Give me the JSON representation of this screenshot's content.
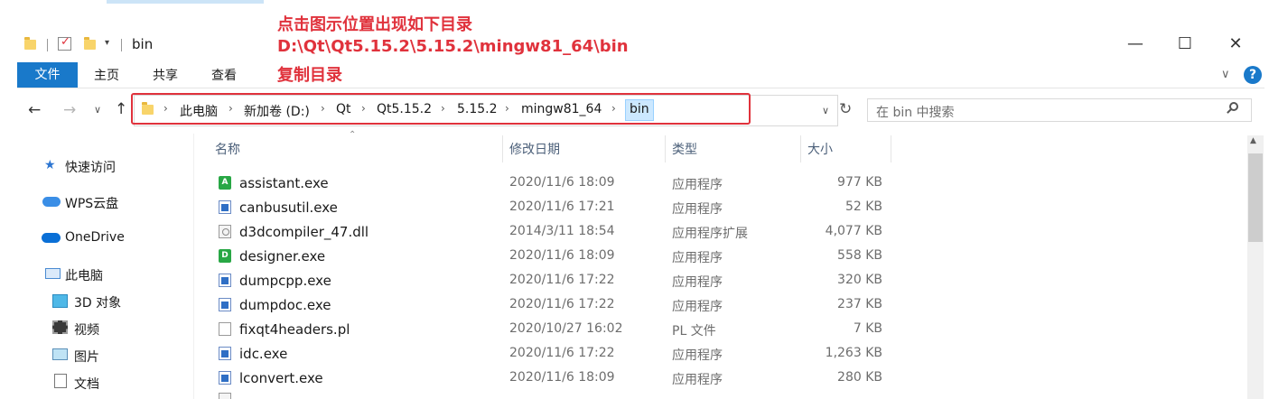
{
  "window": {
    "title": "bin",
    "minimize": "—",
    "maximize": "☐",
    "close": "✕"
  },
  "annotation": {
    "line1": "点击图示位置出现如下目录",
    "line2": "D:\\Qt\\Qt5.15.2\\5.15.2\\mingw81_64\\bin",
    "line3": "复制目录",
    "color": "#e0323c"
  },
  "ribbon": {
    "tabs": [
      "文件",
      "主页",
      "共享",
      "查看"
    ],
    "collapse": "∨",
    "help": "?"
  },
  "address": {
    "back": "←",
    "forward": "→",
    "recent": "∨",
    "up": "↑",
    "crumbs": [
      "此电脑",
      "新加卷 (D:)",
      "Qt",
      "Qt5.15.2",
      "5.15.2",
      "mingw81_64",
      "bin"
    ],
    "dropdown": "∨",
    "refresh": "↻",
    "search_placeholder": "在 bin 中搜索"
  },
  "nav": [
    {
      "label": "快速访问",
      "icon": "star-icon"
    },
    {
      "label": "WPS云盘",
      "icon": "cloud-icon"
    },
    {
      "label": "OneDrive",
      "icon": "onedrive-icon"
    },
    {
      "label": "此电脑",
      "icon": "computer-icon"
    },
    {
      "label": "3D 对象",
      "icon": "cube-icon"
    },
    {
      "label": "视频",
      "icon": "video-icon"
    },
    {
      "label": "图片",
      "icon": "picture-icon"
    },
    {
      "label": "文档",
      "icon": "document-icon"
    }
  ],
  "columns": {
    "name": "名称",
    "date": "修改日期",
    "type": "类型",
    "size": "大小"
  },
  "files": [
    {
      "name": "assistant.exe",
      "date": "2020/11/6 18:09",
      "type": "应用程序",
      "size": "977 KB",
      "icon": "assistant-icon"
    },
    {
      "name": "canbusutil.exe",
      "date": "2020/11/6 17:21",
      "type": "应用程序",
      "size": "52 KB",
      "icon": "exe-icon"
    },
    {
      "name": "d3dcompiler_47.dll",
      "date": "2014/3/11 18:54",
      "type": "应用程序扩展",
      "size": "4,077 KB",
      "icon": "dll-icon"
    },
    {
      "name": "designer.exe",
      "date": "2020/11/6 18:09",
      "type": "应用程序",
      "size": "558 KB",
      "icon": "designer-icon"
    },
    {
      "name": "dumpcpp.exe",
      "date": "2020/11/6 17:22",
      "type": "应用程序",
      "size": "320 KB",
      "icon": "exe-icon"
    },
    {
      "name": "dumpdoc.exe",
      "date": "2020/11/6 17:22",
      "type": "应用程序",
      "size": "237 KB",
      "icon": "exe-icon"
    },
    {
      "name": "fixqt4headers.pl",
      "date": "2020/10/27 16:02",
      "type": "PL 文件",
      "size": "7 KB",
      "icon": "file-icon"
    },
    {
      "name": "idc.exe",
      "date": "2020/11/6 17:22",
      "type": "应用程序",
      "size": "1,263 KB",
      "icon": "exe-icon"
    },
    {
      "name": "lconvert.exe",
      "date": "2020/11/6 18:09",
      "type": "应用程序",
      "size": "280 KB",
      "icon": "exe-icon"
    }
  ]
}
